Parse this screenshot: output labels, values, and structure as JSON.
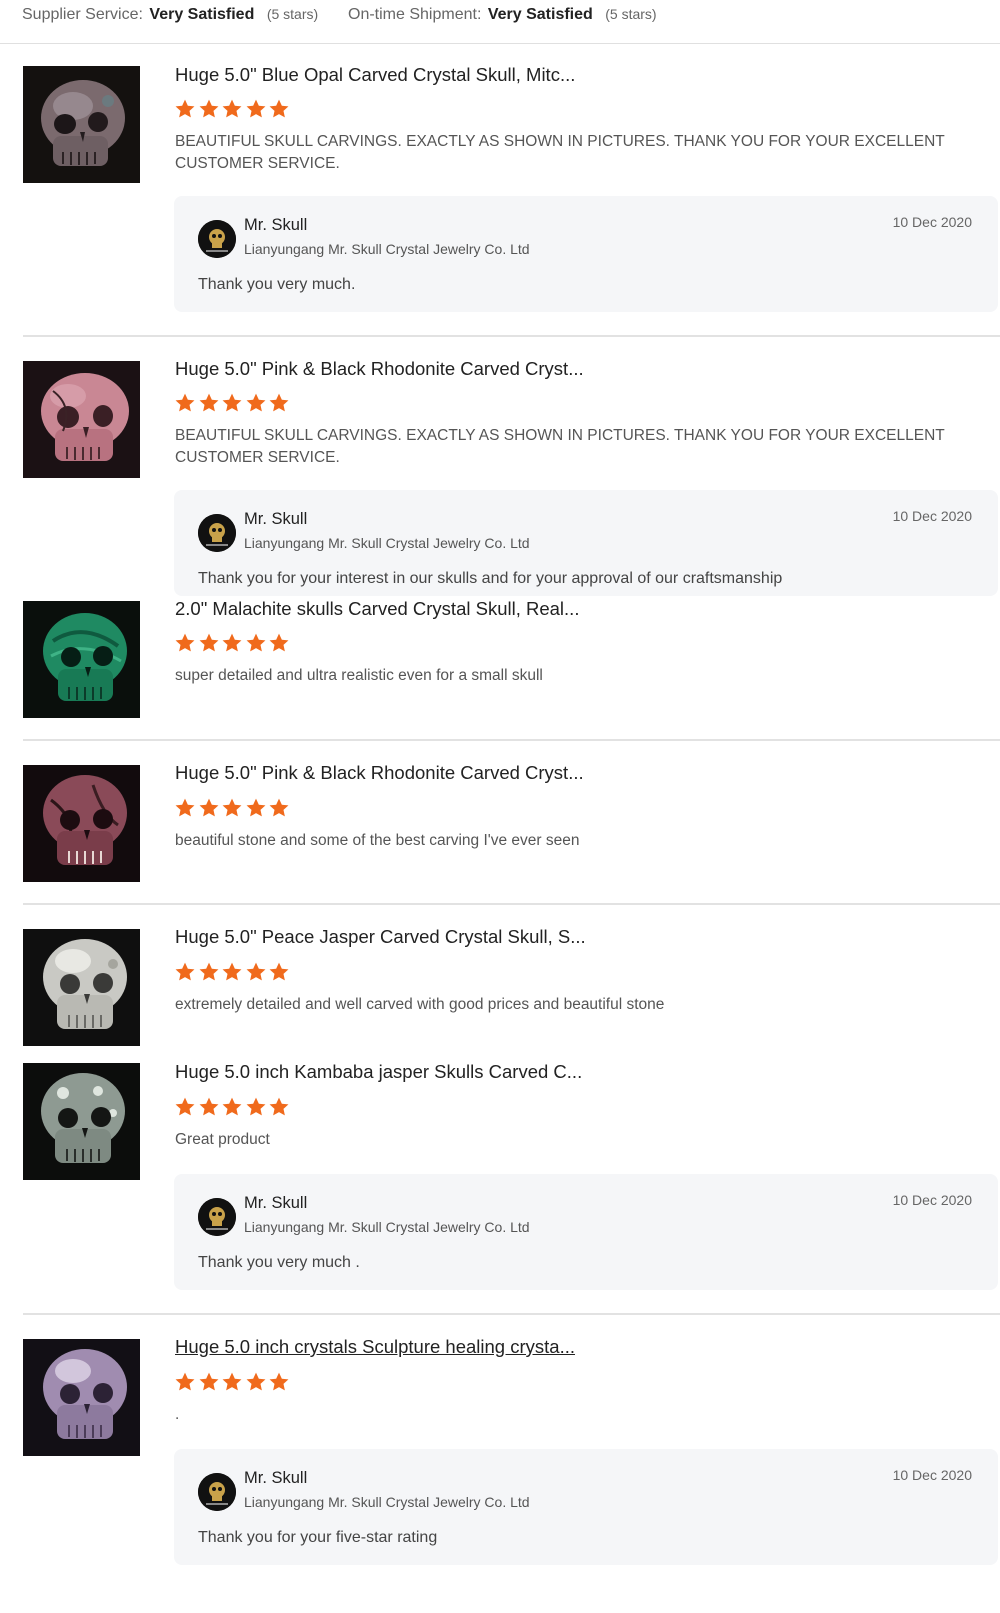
{
  "summary": {
    "supplier_service_label": "Supplier Service:",
    "supplier_service_value": "Very Satisfied",
    "supplier_service_stars": "(5 stars)",
    "shipment_label": "On-time Shipment:",
    "shipment_value": "Very Satisfied",
    "shipment_stars": "(5 stars)"
  },
  "colors": {
    "star": "#f06a1c",
    "reply_bg": "#f5f6f8",
    "divider": "#e2e2e2"
  },
  "reviews": [
    {
      "title": "Huge 5.0\" Blue Opal Carved Crystal Skull, Mitc...",
      "rating": 5,
      "comment": "BEAUTIFUL SKULL CARVINGS. EXACTLY AS SHOWN IN PICTURES. THANK YOU FOR YOUR  EXCELLENT CUSTOMER SERVICE.",
      "thumb_icon": "blue-opal-skull-image",
      "reply": {
        "name": "Mr. Skull",
        "company": "Lianyungang Mr. Skull Crystal Jewelry Co. Ltd",
        "date": "10 Dec 2020",
        "text": "Thank you very much."
      }
    },
    {
      "title": "Huge 5.0\" Pink & Black Rhodonite Carved Cryst...",
      "rating": 5,
      "comment": "BEAUTIFUL SKULL CARVINGS. EXACTLY AS SHOWN IN PICTURES. THANK YOU FOR YOUR  EXCELLENT CUSTOMER SERVICE.",
      "thumb_icon": "pink-rhodonite-skull-image",
      "reply": {
        "name": "Mr. Skull",
        "company": "Lianyungang Mr. Skull Crystal Jewelry Co. Ltd",
        "date": "10 Dec 2020",
        "text": "Thank you for your interest in our skulls and for your approval of our craftsmanship"
      }
    },
    {
      "title": "2.0\" Malachite skulls Carved Crystal Skull, Real...",
      "rating": 5,
      "comment": "super detailed and ultra realistic even for a small skull",
      "thumb_icon": "malachite-skull-image"
    },
    {
      "title": "Huge 5.0\" Pink & Black Rhodonite Carved Cryst...",
      "rating": 5,
      "comment": "beautiful stone and some of the best carving I've ever seen",
      "thumb_icon": "rhodonite-skull-image"
    },
    {
      "title": "Huge 5.0\" Peace Jasper Carved Crystal Skull, S...",
      "rating": 5,
      "comment": "extremely detailed and well carved with good prices and beautiful stone",
      "thumb_icon": "peace-jasper-skull-image"
    },
    {
      "title": "Huge 5.0 inch Kambaba jasper Skulls Carved C...",
      "rating": 5,
      "comment": "Great product",
      "thumb_icon": "kambaba-jasper-skull-image",
      "reply": {
        "name": "Mr. Skull",
        "company": "Lianyungang Mr. Skull Crystal Jewelry Co. Ltd",
        "date": "10 Dec 2020",
        "text": "Thank you very much ."
      }
    },
    {
      "title": "Huge 5.0 inch crystals Sculpture healing crysta...",
      "rating": 5,
      "comment": ".",
      "thumb_icon": "amethyst-skull-image",
      "reply": {
        "name": "Mr. Skull",
        "company": "Lianyungang Mr. Skull Crystal Jewelry Co. Ltd",
        "date": "10 Dec 2020",
        "text": "Thank you for your five-star rating"
      }
    }
  ]
}
